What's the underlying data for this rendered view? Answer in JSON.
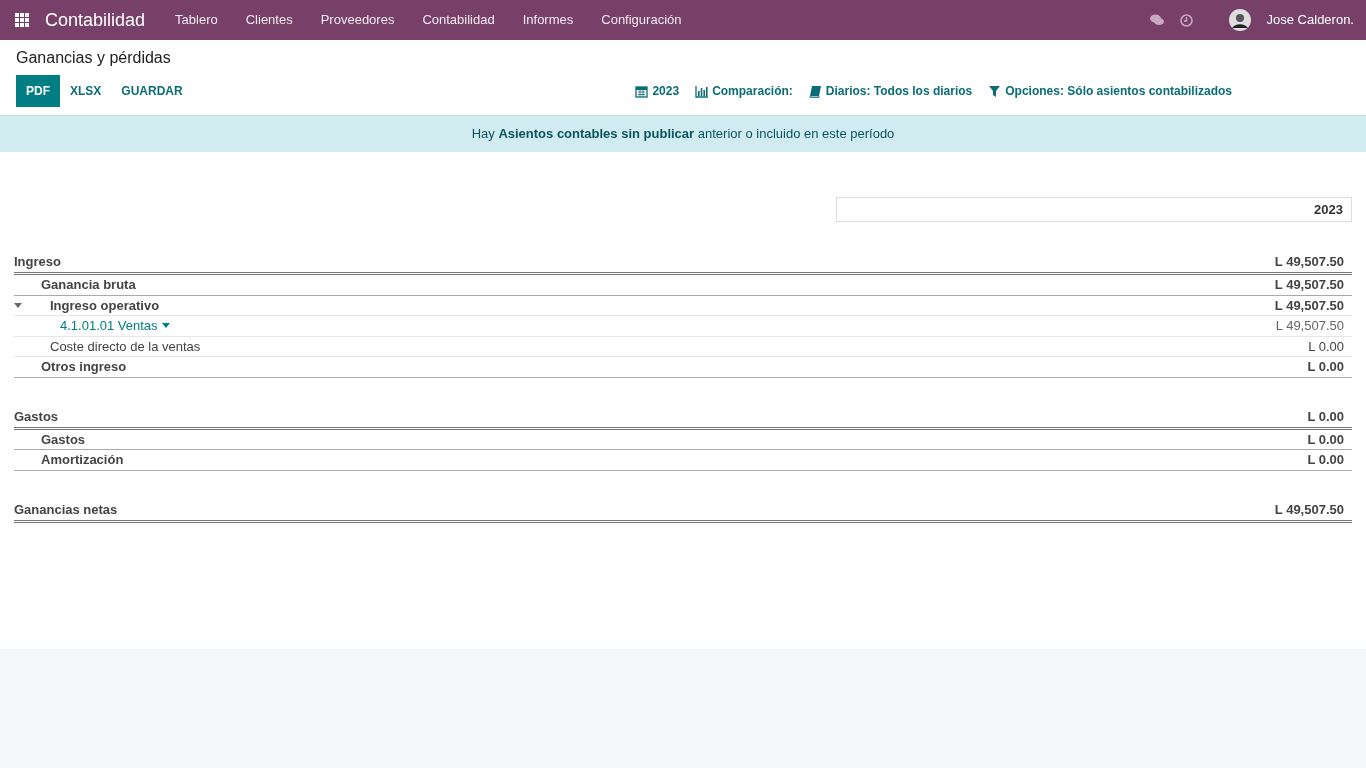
{
  "navbar": {
    "app_title": "Contabilidad",
    "menu": [
      {
        "label": "Tablero"
      },
      {
        "label": "Clientes"
      },
      {
        "label": "Proveedores"
      },
      {
        "label": "Contabilidad"
      },
      {
        "label": "Informes"
      },
      {
        "label": "Configuración"
      }
    ],
    "user": "Jose Calderon."
  },
  "page_title": "Ganancias y pérdidas",
  "actions": [
    {
      "label": "PDF",
      "kind": "primary"
    },
    {
      "label": "XLSX",
      "kind": "link"
    },
    {
      "label": "GUARDAR",
      "kind": "link"
    }
  ],
  "filters": [
    {
      "kind": "period",
      "label": "2023"
    },
    {
      "kind": "comparison",
      "label": "Comparación:"
    },
    {
      "kind": "journals",
      "label": "Diarios: Todos los diarios"
    },
    {
      "kind": "options",
      "label": "Opciones: Sólo asientos contabilizados"
    }
  ],
  "alert": "Hay **Asientos contables sin publicar** anterior o incluido en este período",
  "column_header": "2023",
  "sections": [
    {
      "name": "Ingreso",
      "amount": "L 49,507.50",
      "children": [
        {
          "name": "Ganancia bruta",
          "kind": "group",
          "amount": "L 49,507.50",
          "children": [
            {
              "name": "Ingreso operativo",
              "kind": "subgroup",
              "expanded": true,
              "amount": "L 49,507.50",
              "children": [
                {
                  "name": "4.1.01.01 Ventas",
                  "kind": "account",
                  "amount": "L 49,507.50"
                }
              ]
            },
            {
              "name": "Coste directo de la ventas",
              "kind": "plain",
              "amount": "L 0.00"
            }
          ]
        },
        {
          "name": "Otros ingreso",
          "kind": "group",
          "amount": "L 0.00"
        }
      ]
    },
    {
      "name": "Gastos",
      "amount": "L 0.00",
      "children": [
        {
          "name": "Gastos",
          "kind": "group",
          "amount": "L 0.00"
        },
        {
          "name": "Amortización",
          "kind": "group",
          "amount": "L 0.00"
        }
      ]
    },
    {
      "name": "Ganancias netas",
      "amount": "L 49,507.50"
    }
  ]
}
